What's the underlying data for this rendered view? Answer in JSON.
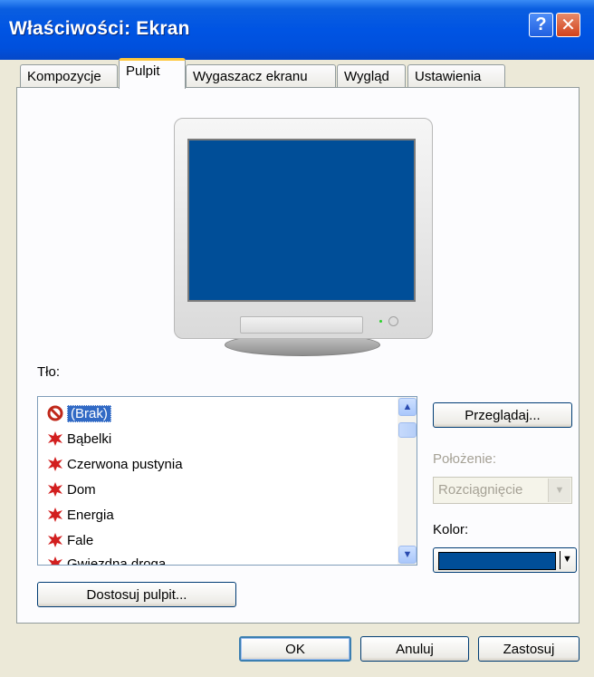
{
  "window": {
    "title": "Właściwości: Ekran",
    "help_glyph": "?",
    "close_glyph": "✕"
  },
  "tabs": [
    {
      "label": "Kompozycje"
    },
    {
      "label": "Pulpit"
    },
    {
      "label": "Wygaszacz ekranu"
    },
    {
      "label": "Wygląd"
    },
    {
      "label": "Ustawienia"
    }
  ],
  "desktop": {
    "background_label": "Tło:",
    "wallpapers": [
      {
        "label": "(Brak)",
        "icon": "no-icon"
      },
      {
        "label": "Bąbelki",
        "icon": "wallpaper-icon"
      },
      {
        "label": "Czerwona pustynia",
        "icon": "wallpaper-icon"
      },
      {
        "label": "Dom",
        "icon": "wallpaper-icon"
      },
      {
        "label": "Energia",
        "icon": "wallpaper-icon"
      },
      {
        "label": "Fale",
        "icon": "wallpaper-icon"
      },
      {
        "label": "Gwiezdna droga",
        "icon": "wallpaper-icon"
      }
    ],
    "browse_label": "Przeglądaj...",
    "position_label": "Położenie:",
    "position_value": "Rozciągnięcie",
    "color_label": "Kolor:",
    "color_value": "#004E98",
    "customize_label": "Dostosuj pulpit..."
  },
  "buttons": {
    "ok": "OK",
    "cancel": "Anuluj",
    "apply": "Zastosuj"
  },
  "colors": {
    "titlebar": "#0054E3",
    "selection": "#316AC5",
    "preview_screen": "#004E98",
    "tab_highlight": "#FFC83C"
  }
}
